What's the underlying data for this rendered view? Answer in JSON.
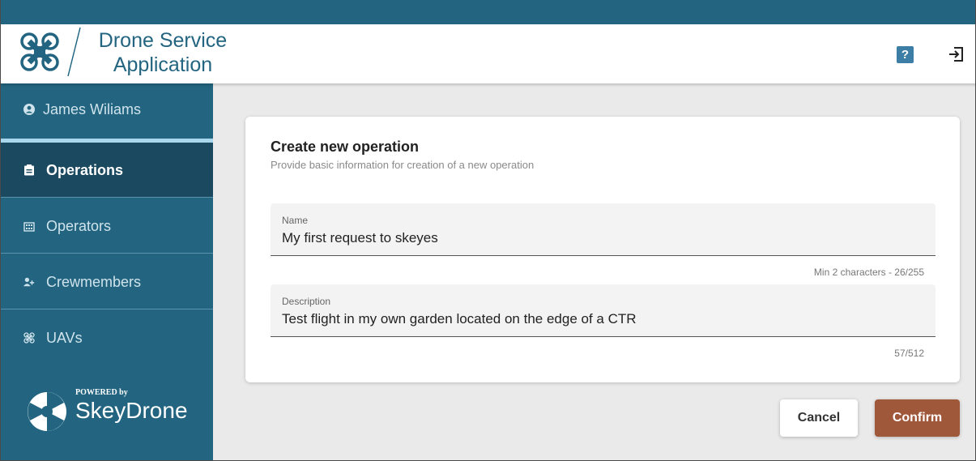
{
  "app": {
    "title_line1": "Drone Service",
    "title_line2": "Application",
    "help_label": "?"
  },
  "sidebar": {
    "user": "James Wiliams",
    "items": [
      {
        "label": "Operations",
        "icon": "clipboard-icon",
        "active": true
      },
      {
        "label": "Operators",
        "icon": "building-icon",
        "active": false
      },
      {
        "label": "Crewmembers",
        "icon": "user-plus-icon",
        "active": false
      },
      {
        "label": "UAVs",
        "icon": "drone-icon",
        "active": false
      }
    ],
    "powered_by": "POWERED by",
    "brand": "SkeyDrone"
  },
  "form": {
    "title": "Create new operation",
    "subtitle": "Provide basic information for creation of a new operation",
    "name_label": "Name",
    "name_value": "My first request to skeyes",
    "name_hint": "Min 2 characters - 26/255",
    "description_label": "Description",
    "description_value": "Test flight in my own garden located on the edge of a CTR",
    "description_hint": "57/512"
  },
  "actions": {
    "cancel": "Cancel",
    "confirm": "Confirm"
  },
  "colors": {
    "brand": "#236580",
    "active_nav": "#1b4a60",
    "confirm": "#a0583a"
  }
}
